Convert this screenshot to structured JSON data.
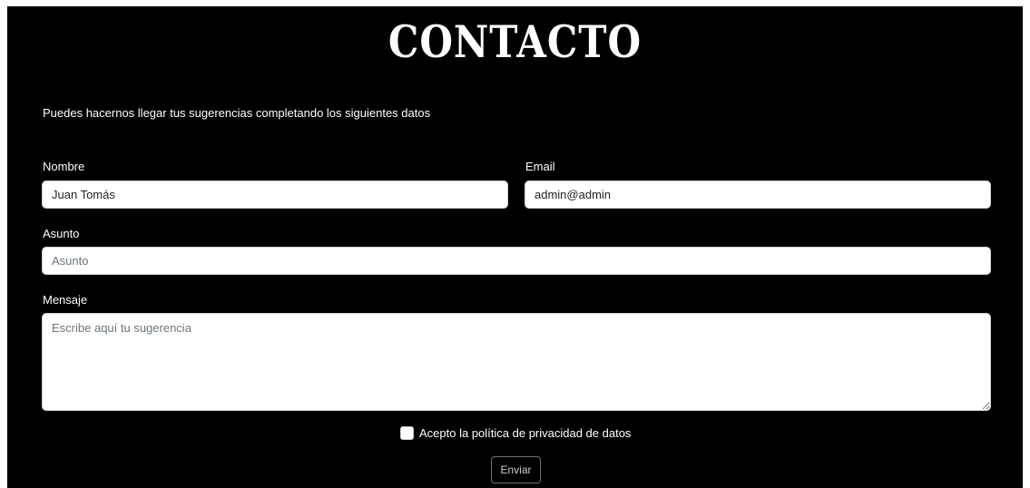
{
  "page": {
    "title": "CONTACTO",
    "intro": "Puedes hacernos llegar tus sugerencias completando los siguientes datos"
  },
  "form": {
    "name": {
      "label": "Nombre",
      "value": "Juan Tomás"
    },
    "email": {
      "label": "Email",
      "value": "admin@admin"
    },
    "subject": {
      "label": "Asunto",
      "placeholder": "Asunto"
    },
    "message": {
      "label": "Mensaje",
      "placeholder": "Escribe aquí tu sugerencia"
    },
    "consent": {
      "label": "Acepto la política de privacidad de datos",
      "checked": false
    },
    "submit_label": "Enviar"
  },
  "colors": {
    "background": "#000000",
    "text": "#ffffff",
    "input_background": "#ffffff"
  }
}
